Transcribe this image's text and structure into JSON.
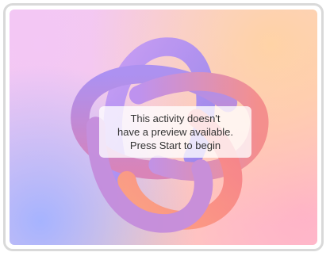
{
  "preview": {
    "message_lines": [
      "This activity doesn't",
      "have a preview available.",
      "Press Start to begin"
    ]
  },
  "colors": {
    "frame_border": "#d9d9d9",
    "knot_purple": "#b98ef0",
    "knot_violet": "#9a86f2",
    "knot_coral": "#f48a8a",
    "knot_orange": "#ff9a7a",
    "text": "#333333"
  },
  "icon": "activity-placeholder-knot"
}
